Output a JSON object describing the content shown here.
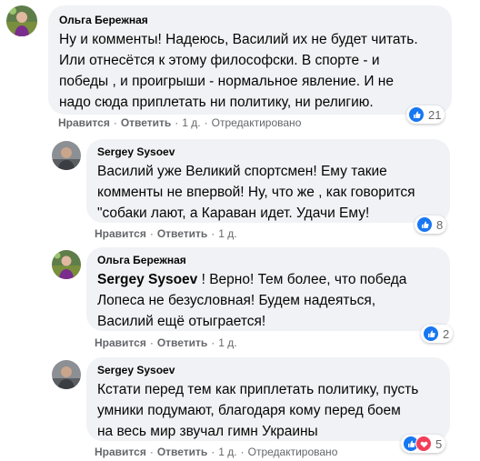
{
  "colors": {
    "bubble": "#f0f2f5",
    "like": "#1877f2",
    "love": "#f33e58",
    "meta": "#65676b"
  },
  "comments": [
    {
      "author": "Ольга Бережная",
      "lines": [
        "Ну и комменты! Надеюсь, Василий их не будет читать.",
        "Или отнесётся к этому философски. В спорте - и",
        "победы , и проигрыши - нормальное явление. И не",
        "надо сюда приплетать ни политику, ни религию."
      ],
      "like_label": "Нравится",
      "reply_label": "Ответить",
      "time": "1 д.",
      "edited": "Отредактировано",
      "reaction_count": "21"
    },
    {
      "author": "Sergey Sysoev",
      "lines": [
        "Василий уже Великий спортсмен! Ему такие",
        "комменты не впервой! Ну, что же , как говорится",
        "\"собаки лают, а Караван идет. Удачи Ему!"
      ],
      "like_label": "Нравится",
      "reply_label": "Ответить",
      "time": "1 д.",
      "reaction_count": "8"
    },
    {
      "author": "Ольга Бережная",
      "mention": "Sergey Sysoev",
      "lines": [
        " ! Верно! Тем более, что победа",
        "Лопеса не безусловная! Будем надеяться,",
        "Василий ещё отыграется!"
      ],
      "like_label": "Нравится",
      "reply_label": "Ответить",
      "time": "1 д.",
      "reaction_count": "2"
    },
    {
      "author": "Sergey Sysoev",
      "lines": [
        "Кстати перед тем как приплетать политику, пусть",
        "умники подумают, благодаря кому перед боем",
        "на весь мир звучал гимн Украины"
      ],
      "like_label": "Нравится",
      "reply_label": "Ответить",
      "time": "1 д.",
      "edited": "Отредактировано",
      "reaction_count": "5"
    }
  ]
}
